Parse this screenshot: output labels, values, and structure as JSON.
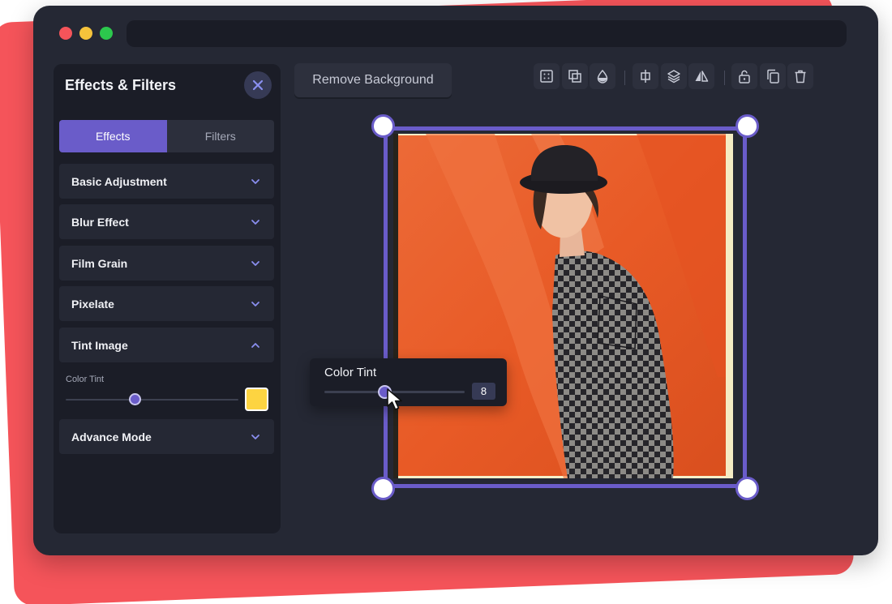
{
  "colors": {
    "accent": "#6a5cc9",
    "window_bg": "#252834",
    "panel_bg": "#1b1d27",
    "decor_red": "#f5545a",
    "traffic_red": "#f5545a",
    "traffic_yellow": "#f5c33b",
    "traffic_green": "#2cc84d",
    "tint_swatch": "#fdd441"
  },
  "panel": {
    "title": "Effects & Filters",
    "close_icon": "close-icon",
    "tabs": [
      {
        "label": "Effects",
        "active": true
      },
      {
        "label": "Filters",
        "active": false
      }
    ],
    "items": [
      {
        "label": "Basic Adjustment",
        "icon": "chevron-down-icon"
      },
      {
        "label": "Blur Effect",
        "icon": "chevron-down-icon"
      },
      {
        "label": "Film Grain",
        "icon": "chevron-down-icon"
      },
      {
        "label": "Pixelate",
        "icon": "chevron-down-icon"
      },
      {
        "label": "Tint Image",
        "icon": "chevron-up-icon"
      },
      {
        "label": "Advance Mode",
        "icon": "chevron-down-icon"
      }
    ],
    "tint": {
      "label": "Color Tint",
      "level": 0.4
    }
  },
  "toolbar": {
    "remove_background_label": "Remove Background",
    "tools": [
      "grid-icon",
      "duplicate-layer-icon",
      "opacity-drop-icon",
      "align-center-icon",
      "layers-icon",
      "flip-icon",
      "unlock-icon",
      "copy-icon",
      "trash-icon"
    ]
  },
  "popup": {
    "label": "Color Tint",
    "value": "8",
    "level": 0.43
  }
}
